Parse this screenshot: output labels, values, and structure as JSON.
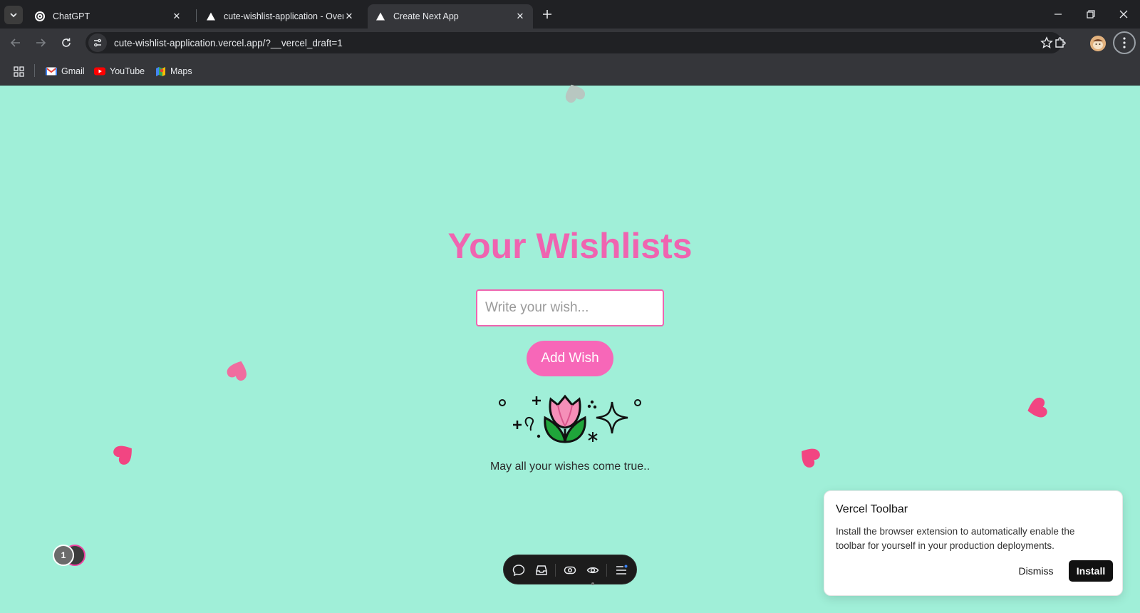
{
  "browser": {
    "tabs": [
      {
        "title": "ChatGPT",
        "favicon": "chatgpt-icon",
        "active": false
      },
      {
        "title": "cute-wishlist-application - Over",
        "favicon": "vercel-triangle-icon",
        "active": false
      },
      {
        "title": "Create Next App",
        "favicon": "vercel-triangle-icon",
        "active": true
      }
    ],
    "address": "cute-wishlist-application.vercel.app/?__vercel_draft=1",
    "bookmarks": [
      {
        "label": "Gmail",
        "icon": "gmail-icon"
      },
      {
        "label": "YouTube",
        "icon": "youtube-icon"
      },
      {
        "label": "Maps",
        "icon": "maps-icon"
      }
    ]
  },
  "page": {
    "title": "Your Wishlists",
    "input_placeholder": "Write your wish...",
    "add_button": "Add Wish",
    "tagline": "May all your wishes come true..",
    "hearts_color": "#f24582",
    "accent": "#ef64b0",
    "background": "#a0efd8"
  },
  "vercel": {
    "avatar_count": "1",
    "toolbar_icons": [
      "comment-icon",
      "inbox-icon",
      "toggle-icon",
      "eye-icon",
      "menu-icon"
    ],
    "card": {
      "title": "Vercel Toolbar",
      "body": "Install the browser extension to automatically enable the toolbar for yourself in your production deployments.",
      "dismiss": "Dismiss",
      "install": "Install"
    }
  }
}
